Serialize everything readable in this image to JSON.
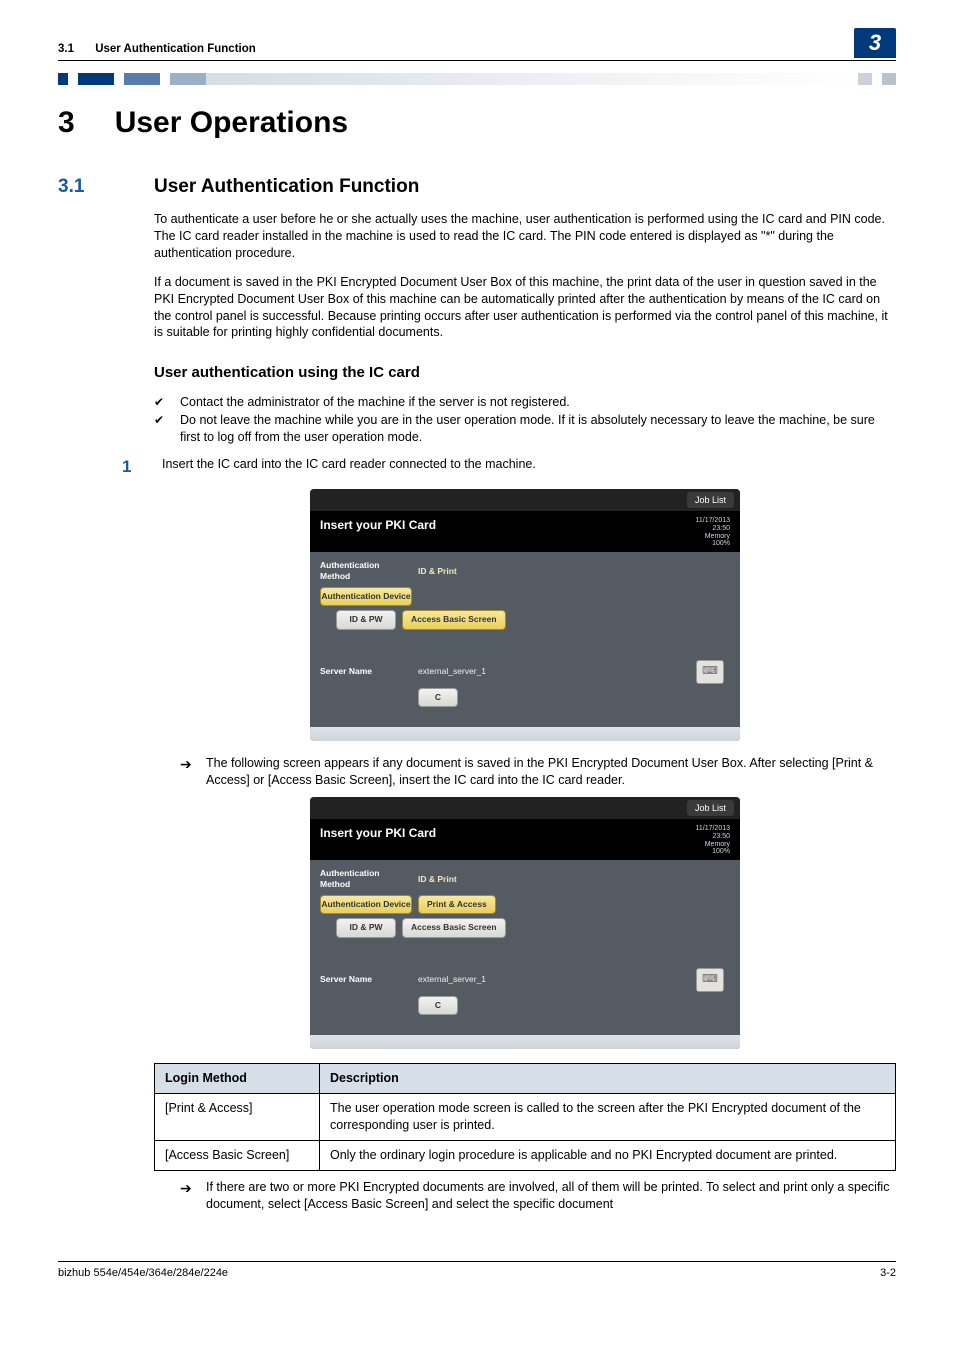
{
  "header": {
    "section_number": "3.1",
    "section_title": "User Authentication Function",
    "chapter_tab": "3"
  },
  "h1": {
    "num": "3",
    "txt": "User Operations"
  },
  "h2": {
    "num": "3.1",
    "txt": "User Authentication Function"
  },
  "paragraphs": {
    "p1": "To authenticate a user before he or she actually uses the machine, user authentication is performed using the IC card and PIN code. The IC card reader installed in the machine is used to read the IC card. The PIN code entered is displayed as \"*\" during the authentication procedure.",
    "p2": "If a document is saved in the PKI Encrypted Document User Box of this machine, the print data of the user in question saved in the PKI Encrypted Document User Box of this machine can be automatically printed after the authentication by means of the IC card on the control panel is successful. Because printing occurs after user authentication is performed via the control panel of this machine, it is suitable for printing highly confidential documents."
  },
  "h3": "User authentication using the IC card",
  "checks": [
    "Contact the administrator of the machine if the server is not registered.",
    "Do not leave the machine while you are in the user operation mode. If it is absolutely necessary to leave the machine, be sure first to log off from the user operation mode."
  ],
  "step1": {
    "num": "1",
    "txt": "Insert the IC card into the IC card reader connected to the machine."
  },
  "screenshot": {
    "job_list": "Job List",
    "title": "Insert your PKI Card",
    "meta_date": "11/17/2013",
    "meta_time": "23:50",
    "meta_mem_lbl": "Memory",
    "meta_mem_val": "100%",
    "auth_method_lbl": "Authentication Method",
    "auth_method_val": "ID & Print",
    "auth_device_btn": "Authentication Device",
    "id_pw_btn": "ID & PW",
    "access_basic_btn": "Access Basic Screen",
    "print_access_btn": "Print & Access",
    "server_lbl": "Server Name",
    "server_val": "external_server_1",
    "clear_btn": "C"
  },
  "arrow1": "The following screen appears if any document is saved in the PKI Encrypted Document User Box. After selecting [Print & Access] or [Access Basic Screen], insert the IC card into the IC card reader.",
  "table": {
    "head_method": "Login Method",
    "head_desc": "Description",
    "rows": [
      {
        "method": "[Print & Access]",
        "desc": "The user operation mode screen is called to the screen after the PKI Encrypted document of the corresponding user is printed."
      },
      {
        "method": "[Access Basic Screen]",
        "desc": "Only the ordinary login procedure is applicable and no PKI Encrypted document are printed."
      }
    ]
  },
  "arrow2": "If there are two or more PKI Encrypted documents are involved, all of them will be printed. To select and print only a specific document, select [Access Basic Screen] and select the specific document",
  "footer": {
    "left": "bizhub 554e/454e/364e/284e/224e",
    "right": "3-2"
  }
}
